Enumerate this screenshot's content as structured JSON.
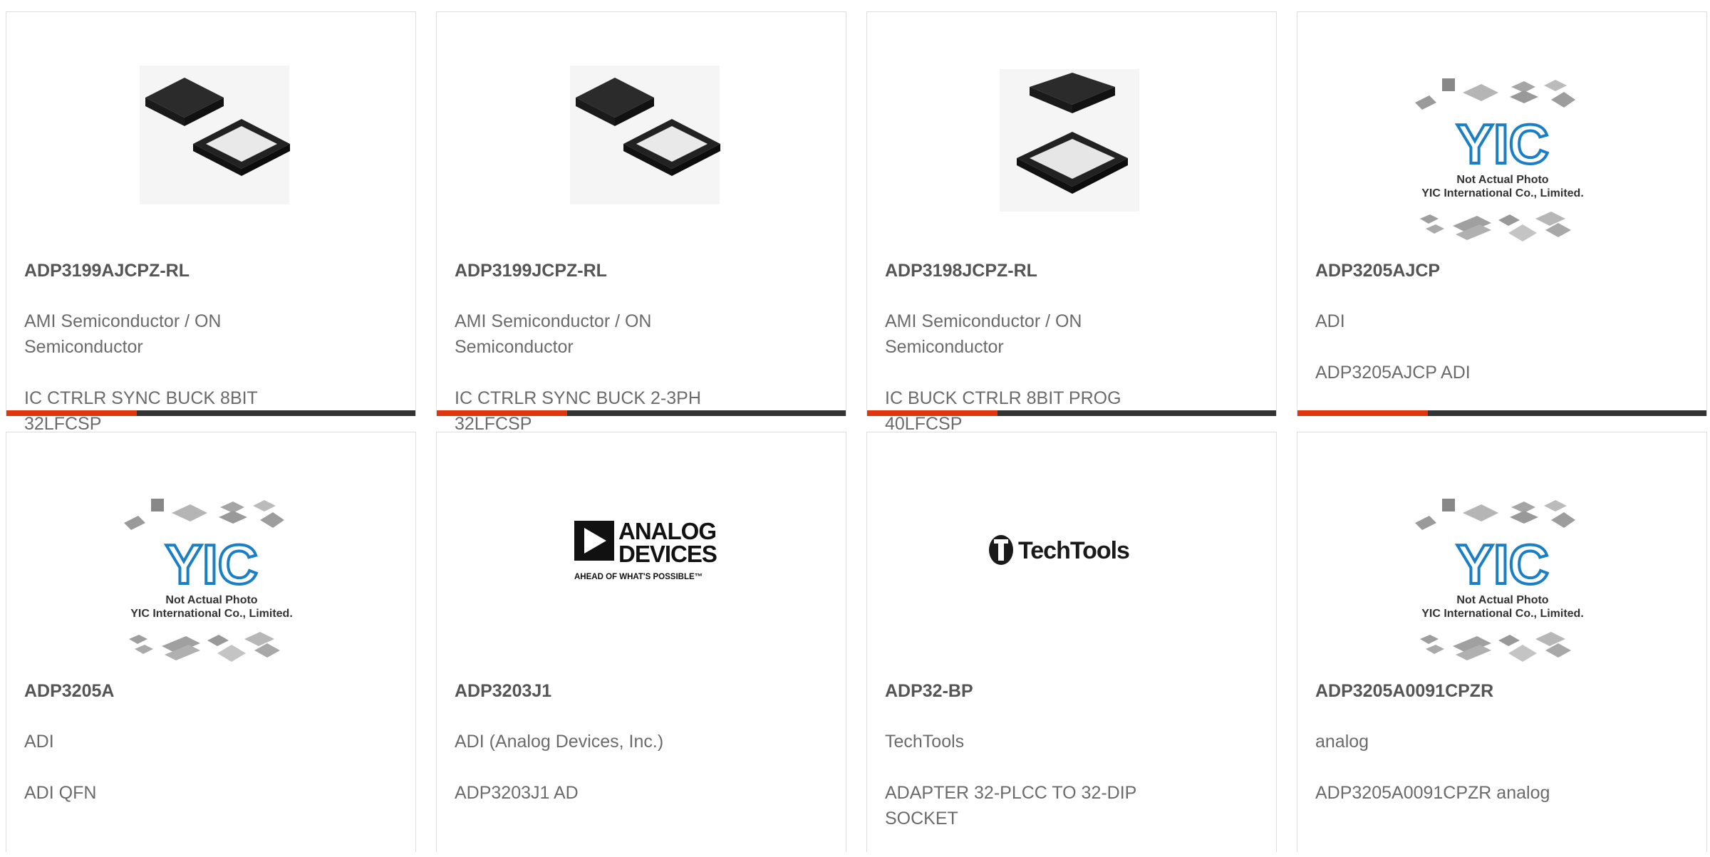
{
  "accent_color": "#e0360e",
  "bar_color": "#333333",
  "products": [
    {
      "part": "ADP3199AJCPZ-RL",
      "line1": "AMI Semiconductor / ON Semiconductor",
      "line2": "IC CTRLR SYNC BUCK 8BIT 32LFCSP",
      "image": "qfn-chip-photo"
    },
    {
      "part": "ADP3199JCPZ-RL",
      "line1": "AMI Semiconductor / ON Semiconductor",
      "line2": "IC CTRLR SYNC BUCK 2-3PH 32LFCSP",
      "image": "qfn-chip-photo"
    },
    {
      "part": "ADP3198JCPZ-RL",
      "line1": "AMI Semiconductor / ON Semiconductor",
      "line2": "IC BUCK CTRLR 8BIT PROG 40LFCSP",
      "image": "qfn-chip-photo"
    },
    {
      "part": "ADP3205AJCP",
      "line1": "ADI",
      "line2": "ADP3205AJCP ADI",
      "image": "yic-placeholder"
    },
    {
      "part": "ADP3205A",
      "line1": "ADI",
      "line2": "ADI QFN",
      "image": "yic-placeholder"
    },
    {
      "part": "ADP3203J1",
      "line1": "ADI (Analog Devices, Inc.)",
      "line2": "ADP3203J1 AD",
      "image": "analog-devices-logo"
    },
    {
      "part": "ADP32-BP",
      "line1": "TechTools",
      "line2": "ADAPTER 32-PLCC TO 32-DIP SOCKET",
      "image": "techtools-logo"
    },
    {
      "part": "ADP3205A0091CPZR",
      "line1": "analog",
      "line2": "ADP3205A0091CPZR analog",
      "image": "yic-placeholder"
    }
  ],
  "yic": {
    "logo_text": "YIC",
    "caption1": "Not Actual Photo",
    "caption2": "YIC International Co., Limited."
  },
  "analog_logo": {
    "line1": "ANALOG",
    "line2": "DEVICES",
    "tagline": "AHEAD OF WHAT'S POSSIBLE™"
  },
  "techtools_logo": {
    "text": "TechTools"
  }
}
